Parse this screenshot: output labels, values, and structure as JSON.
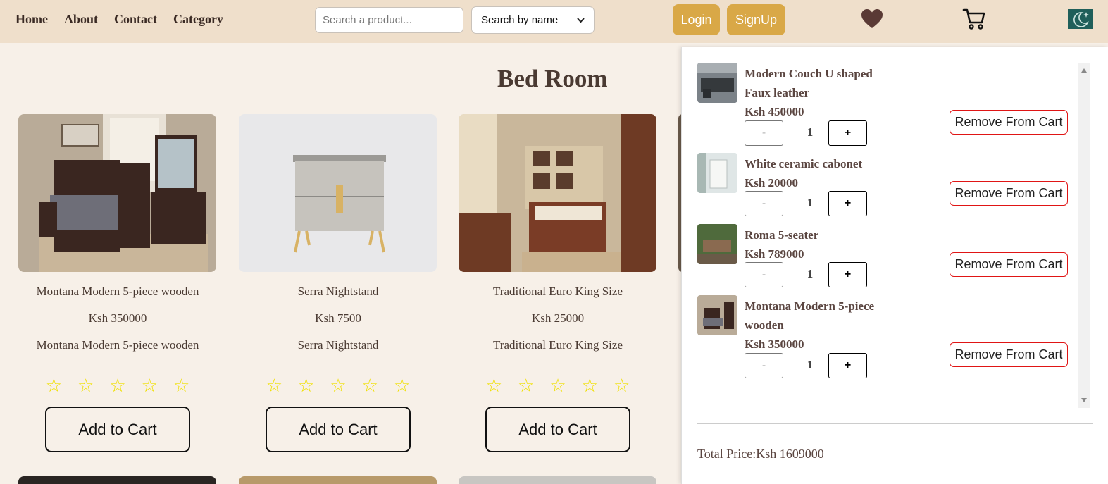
{
  "nav": {
    "home": "Home",
    "about": "About",
    "contact": "Contact",
    "category": "Category"
  },
  "search": {
    "placeholder": "Search a product...",
    "mode_selected": "Search by name"
  },
  "auth": {
    "login": "Login",
    "signup": "SignUp"
  },
  "colors": {
    "header_bg": "#efdfcb",
    "page_bg": "#f7f0e8",
    "accent_gold": "#d9a847",
    "text_brown": "#4a3a32",
    "star_yellow": "#f0e000",
    "remove_red": "#e01515",
    "theme_toggle": "#1f5f5a"
  },
  "icons": {
    "wishlist": "heart-icon",
    "cart": "cart-icon",
    "theme": "moon-icon"
  },
  "section": {
    "title": "Bed Room"
  },
  "products": [
    {
      "name": "Montana Modern 5-piece wooden",
      "price": "Ksh 350000",
      "desc": "Montana Modern 5-piece wooden",
      "stars": [
        "☆",
        "☆",
        "☆",
        "☆",
        "☆"
      ],
      "add_label": "Add to Cart"
    },
    {
      "name": "Serra Nightstand",
      "price": "Ksh 7500",
      "desc": "Serra Nightstand",
      "stars": [
        "☆",
        "☆",
        "☆",
        "☆",
        "☆"
      ],
      "add_label": "Add to Cart"
    },
    {
      "name": "Traditional Euro King Size",
      "price": "Ksh 25000",
      "desc": "Traditional Euro King Size",
      "stars": [
        "☆",
        "☆",
        "☆",
        "☆",
        "☆"
      ],
      "add_label": "Add to Cart"
    }
  ],
  "cart": {
    "items": [
      {
        "title": "Modern Couch U shaped Faux leather",
        "price": "Ksh 450000",
        "minus": "-",
        "qty": "1",
        "plus": "+",
        "remove": "Remove From Cart"
      },
      {
        "title": "White ceramic cabonet",
        "price": "Ksh 20000",
        "minus": "-",
        "qty": "1",
        "plus": "+",
        "remove": "Remove From Cart"
      },
      {
        "title": "Roma 5-seater",
        "price": "Ksh 789000",
        "minus": "-",
        "qty": "1",
        "plus": "+",
        "remove": "Remove From Cart"
      },
      {
        "title": "Montana Modern 5-piece wooden",
        "price": "Ksh 350000",
        "minus": "-",
        "qty": "1",
        "plus": "+",
        "remove": "Remove From Cart"
      }
    ],
    "total": "Total Price:Ksh 1609000"
  }
}
